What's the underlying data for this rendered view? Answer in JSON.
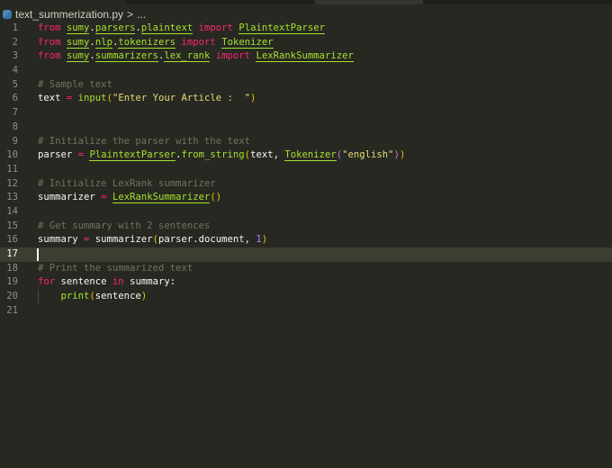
{
  "breadcrumb": {
    "file": "text_summerization.py",
    "separator": ">",
    "more": "..."
  },
  "cursor_line": 17,
  "lines": [
    [
      [
        "kw",
        "from"
      ],
      [
        "pl",
        " "
      ],
      [
        "mod",
        "sumy"
      ],
      [
        "pl",
        "."
      ],
      [
        "mod",
        "parsers"
      ],
      [
        "pl",
        "."
      ],
      [
        "mod",
        "plaintext"
      ],
      [
        "pl",
        " "
      ],
      [
        "kw",
        "import"
      ],
      [
        "pl",
        " "
      ],
      [
        "cls",
        "PlaintextParser"
      ]
    ],
    [
      [
        "kw",
        "from"
      ],
      [
        "pl",
        " "
      ],
      [
        "mod",
        "sumy"
      ],
      [
        "pl",
        "."
      ],
      [
        "mod",
        "nlp"
      ],
      [
        "pl",
        "."
      ],
      [
        "mod",
        "tokenizers"
      ],
      [
        "pl",
        " "
      ],
      [
        "kw",
        "import"
      ],
      [
        "pl",
        " "
      ],
      [
        "cls",
        "Tokenizer"
      ]
    ],
    [
      [
        "kw",
        "from"
      ],
      [
        "pl",
        " "
      ],
      [
        "mod",
        "sumy"
      ],
      [
        "pl",
        "."
      ],
      [
        "mod",
        "summarizers"
      ],
      [
        "pl",
        "."
      ],
      [
        "mod",
        "lex_rank"
      ],
      [
        "pl",
        " "
      ],
      [
        "kw",
        "import"
      ],
      [
        "pl",
        " "
      ],
      [
        "cls",
        "LexRankSummarizer"
      ]
    ],
    [],
    [
      [
        "cm",
        "# Sample text"
      ]
    ],
    [
      [
        "pl",
        "text "
      ],
      [
        "op",
        "="
      ],
      [
        "pl",
        " "
      ],
      [
        "fn",
        "input"
      ],
      [
        "br",
        "("
      ],
      [
        "str",
        "\"Enter Your Article :  \""
      ],
      [
        "br",
        ")"
      ]
    ],
    [],
    [],
    [
      [
        "cm",
        "# Initialize the parser with the text"
      ]
    ],
    [
      [
        "pl",
        "parser "
      ],
      [
        "op",
        "="
      ],
      [
        "pl",
        " "
      ],
      [
        "cls",
        "PlaintextParser"
      ],
      [
        "pl",
        "."
      ],
      [
        "fn",
        "from_string"
      ],
      [
        "br",
        "("
      ],
      [
        "pl",
        "text, "
      ],
      [
        "cls",
        "Tokenizer"
      ],
      [
        "br2",
        "("
      ],
      [
        "str",
        "\"english\""
      ],
      [
        "br2",
        ")"
      ],
      [
        "br",
        ")"
      ]
    ],
    [],
    [
      [
        "cm",
        "# Initialize LexRank summarizer"
      ]
    ],
    [
      [
        "pl",
        "summarizer "
      ],
      [
        "op",
        "="
      ],
      [
        "pl",
        " "
      ],
      [
        "cls",
        "LexRankSummarizer"
      ],
      [
        "br",
        "()"
      ]
    ],
    [],
    [
      [
        "cm",
        "# Get summary with 2 sentences"
      ]
    ],
    [
      [
        "pl",
        "summary "
      ],
      [
        "op",
        "="
      ],
      [
        "pl",
        " summarizer"
      ],
      [
        "br",
        "("
      ],
      [
        "pl",
        "parser.document, "
      ],
      [
        "num",
        "1"
      ],
      [
        "br",
        ")"
      ]
    ],
    [],
    [
      [
        "cm",
        "# Print the summarized text"
      ]
    ],
    [
      [
        "kw",
        "for"
      ],
      [
        "pl",
        " sentence "
      ],
      [
        "kw",
        "in"
      ],
      [
        "pl",
        " summary:"
      ]
    ],
    [
      [
        "pl",
        "    "
      ],
      [
        "fn",
        "print"
      ],
      [
        "br",
        "("
      ],
      [
        "pl",
        "sentence"
      ],
      [
        "br",
        ")"
      ]
    ],
    []
  ]
}
